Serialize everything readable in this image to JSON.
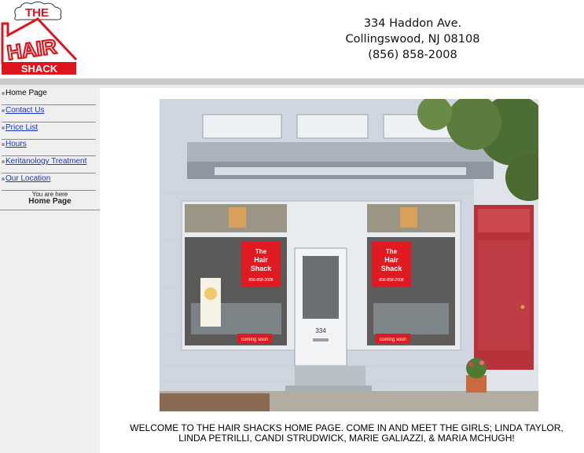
{
  "logo": {
    "alt_text": "THE HAIR SHACK",
    "the": "THE",
    "hair": "HAIR",
    "shack": "SHACK"
  },
  "address": {
    "street": "334 Haddon Ave.",
    "city": "Collingswood, NJ 08108",
    "phone": "(856) 858-2008"
  },
  "nav": {
    "items": [
      {
        "label": "Home Page",
        "active": true
      },
      {
        "label": "Contact Us",
        "active": false
      },
      {
        "label": "Price List",
        "active": false
      },
      {
        "label": "Hours",
        "active": false
      },
      {
        "label": "Keritanology Treatment",
        "active": false
      },
      {
        "label": "Our Location",
        "active": false
      }
    ],
    "you_are_here": "You are here",
    "current_page": "Home Page"
  },
  "photo": {
    "sign_line1": "The",
    "sign_line2": "Hair",
    "sign_line3": "Shack",
    "sign_phone": "856-858-2008",
    "door_number": "334",
    "coming_soon": "coming soon"
  },
  "welcome": {
    "line1": "WELCOME TO THE HAIR SHACKS HOME PAGE.  COME IN AND MEET THE GIRLS; LINDA TAYLOR,",
    "line2": "LINDA PETRILLI, CANDI STRUDWICK, MARIE GALIAZZI, & MARIA MCHUGH!"
  },
  "colors": {
    "logo_red": "#e0141c",
    "link_blue": "#1a33cc",
    "sidebar_bg": "#efefef",
    "band_gray": "#c9c9c9",
    "door_red": "#b8323a"
  }
}
